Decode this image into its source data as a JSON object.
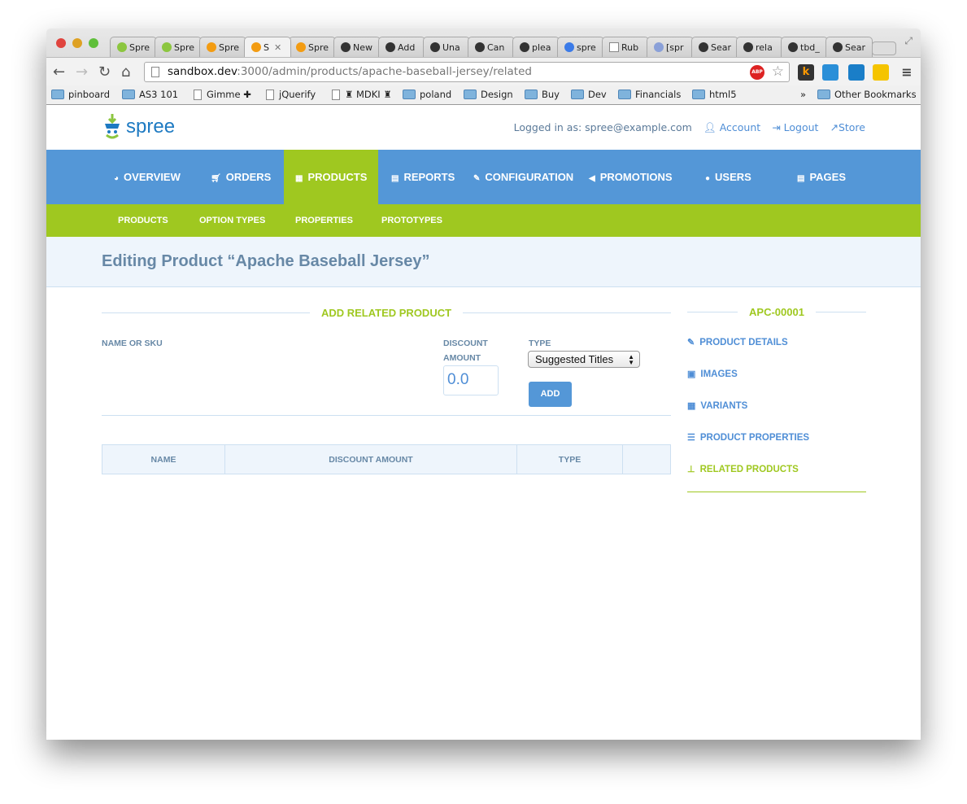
{
  "browser": {
    "tabs": [
      {
        "label": "Spre",
        "icon": "spree-icon"
      },
      {
        "label": "Spre",
        "icon": "spree-icon"
      },
      {
        "label": "Spre",
        "icon": "rss-icon"
      },
      {
        "label": "S",
        "icon": "rss-icon",
        "active": true
      },
      {
        "label": "Spre",
        "icon": "rss-icon"
      },
      {
        "label": "New",
        "icon": "github-icon"
      },
      {
        "label": "Add",
        "icon": "github-icon"
      },
      {
        "label": "Una",
        "icon": "github-icon"
      },
      {
        "label": "Can",
        "icon": "github-icon"
      },
      {
        "label": "plea",
        "icon": "github-icon"
      },
      {
        "label": "spre",
        "icon": "google-icon"
      },
      {
        "label": "Rub",
        "icon": "page-icon"
      },
      {
        "label": "[spr",
        "icon": "gb-icon"
      },
      {
        "label": "Sear",
        "icon": "github-icon"
      },
      {
        "label": "rela",
        "icon": "github-icon"
      },
      {
        "label": "tbd_",
        "icon": "github-icon"
      },
      {
        "label": "Sear",
        "icon": "github-icon"
      }
    ],
    "url_host": "sandbox.dev",
    "url_rest": ":3000/admin/products/apache-baseball-jersey/related",
    "abp_label": "ABP",
    "ext_k": "k",
    "bookmarks": [
      {
        "label": "pinboard",
        "type": "folder"
      },
      {
        "label": "AS3 101",
        "type": "folder"
      },
      {
        "label": "Gimme ✚",
        "type": "page"
      },
      {
        "label": "jQuerify",
        "type": "page"
      },
      {
        "label": "♜ MDKI ♜",
        "type": "page"
      },
      {
        "label": "poland",
        "type": "folder"
      },
      {
        "label": "Design",
        "type": "folder"
      },
      {
        "label": "Buy",
        "type": "folder"
      },
      {
        "label": "Dev",
        "type": "folder"
      },
      {
        "label": "Financials",
        "type": "folder"
      },
      {
        "label": "html5",
        "type": "folder"
      }
    ],
    "bookmarks_overflow": "»",
    "other_bookmarks": "Other Bookmarks"
  },
  "header": {
    "logo_text": "spree",
    "logged_in": "Logged in as: spree@example.com",
    "account": "Account",
    "logout": "Logout",
    "store": "Store"
  },
  "nav": {
    "items": [
      {
        "label": "OVERVIEW",
        "icon": "dashboard-icon"
      },
      {
        "label": "ORDERS",
        "icon": "cart-icon"
      },
      {
        "label": "PRODUCTS",
        "icon": "grid-icon",
        "active": true
      },
      {
        "label": "REPORTS",
        "icon": "file-icon"
      },
      {
        "label": "CONFIGURATION",
        "icon": "wrench-icon"
      },
      {
        "label": "PROMOTIONS",
        "icon": "bullhorn-icon"
      },
      {
        "label": "USERS",
        "icon": "user-icon"
      },
      {
        "label": "PAGES",
        "icon": "file-icon"
      }
    ]
  },
  "subnav": {
    "items": [
      "PRODUCTS",
      "OPTION TYPES",
      "PROPERTIES",
      "PROTOTYPES"
    ],
    "active": "PRODUCTS"
  },
  "page": {
    "title": "Editing Product “Apache Baseball Jersey”"
  },
  "form": {
    "heading": "ADD RELATED PRODUCT",
    "name_label": "NAME OR SKU",
    "discount_label_1": "DISCOUNT",
    "discount_label_2": "AMOUNT",
    "discount_value": "0.0",
    "type_label": "TYPE",
    "type_value": "Suggested Titles",
    "add_label": "ADD"
  },
  "table": {
    "headers": [
      "NAME",
      "DISCOUNT AMOUNT",
      "TYPE",
      ""
    ]
  },
  "sidebar": {
    "sku": "APC-00001",
    "items": [
      {
        "label": "PRODUCT DETAILS",
        "icon": "edit-icon"
      },
      {
        "label": "IMAGES",
        "icon": "image-icon"
      },
      {
        "label": "VARIANTS",
        "icon": "grid-icon"
      },
      {
        "label": "PRODUCT PROPERTIES",
        "icon": "list-icon"
      },
      {
        "label": "RELATED PRODUCTS",
        "icon": "sitemap-icon",
        "active": true
      }
    ]
  },
  "colors": {
    "blue": "#5497d7",
    "green": "#9fc820",
    "title": "#6788a6",
    "band": "#eef5fc"
  }
}
